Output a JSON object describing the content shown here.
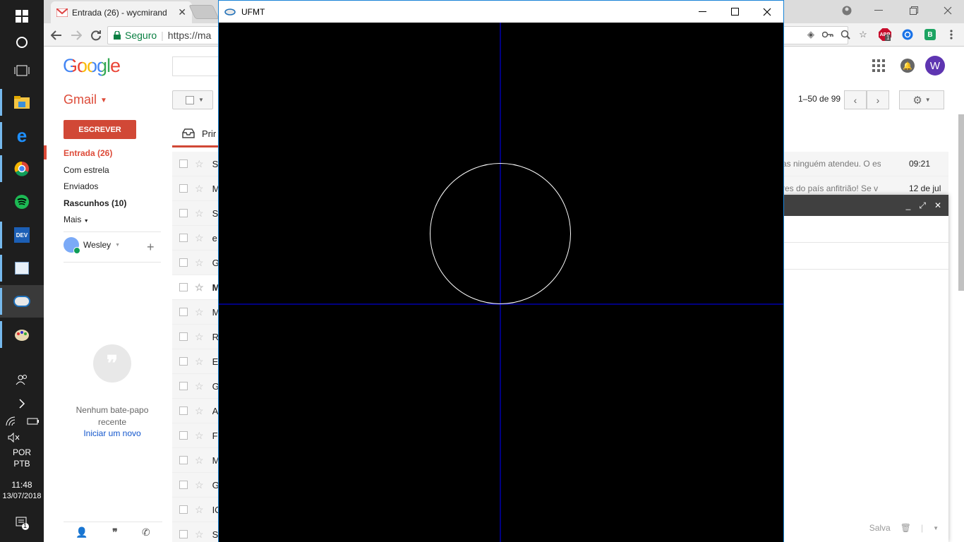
{
  "taskbar": {
    "lang_line1": "POR",
    "lang_line2": "PTB",
    "time": "11:48",
    "date": "13/07/2018",
    "notification_count": "1"
  },
  "chrome": {
    "tab_title": "Entrada (26) - wycmirand",
    "secure_label": "Seguro",
    "url": "https://ma",
    "abp_badge": "1"
  },
  "gmail": {
    "logo": "Google",
    "product": "Gmail",
    "compose": "ESCREVER",
    "nav": {
      "inbox": "Entrada (26)",
      "starred": "Com estrela",
      "sent": "Enviados",
      "drafts": "Rascunhos (10)",
      "more": "Mais"
    },
    "user": "Wesley",
    "avatar_letter": "W",
    "pager": "1–50 de 99",
    "inbox_tab": "Prir",
    "no_chat": "Nenhum bate-papo recente",
    "start_chat": "Iniciar um novo",
    "compose_save": "Salva",
    "emails": [
      {
        "sender": "S",
        "snippet": "as ninguém atendeu. O es",
        "date": "09:21",
        "unread": false
      },
      {
        "sender": "M",
        "snippet": "res do país anfitrião! Se v",
        "date": "12 de jul",
        "unread": false
      },
      {
        "sender": "S",
        "snippet": "",
        "date": "",
        "unread": false
      },
      {
        "sender": "e",
        "snippet": "",
        "date": "",
        "unread": false
      },
      {
        "sender": "G",
        "snippet": "",
        "date": "",
        "unread": false
      },
      {
        "sender": "M",
        "snippet": "",
        "date": "",
        "unread": true
      },
      {
        "sender": "M",
        "snippet": "",
        "date": "",
        "unread": false
      },
      {
        "sender": "R",
        "snippet": "",
        "date": "",
        "unread": false
      },
      {
        "sender": "E",
        "snippet": "",
        "date": "",
        "unread": false
      },
      {
        "sender": "G",
        "snippet": "",
        "date": "",
        "unread": false
      },
      {
        "sender": "A",
        "snippet": "",
        "date": "",
        "unread": false
      },
      {
        "sender": "F",
        "snippet": "",
        "date": "",
        "unread": false
      },
      {
        "sender": "M",
        "snippet": "",
        "date": "",
        "unread": false
      },
      {
        "sender": "G",
        "snippet": "",
        "date": "",
        "unread": false
      },
      {
        "sender": "IC",
        "snippet": "",
        "date": "",
        "unread": false
      },
      {
        "sender": "S",
        "snippet": "",
        "date": "",
        "unread": false
      }
    ]
  },
  "ufmt": {
    "title": "UFMT",
    "canvas_colors": {
      "background": "#000000",
      "axes": "#0000ff",
      "circle": "#ffffff"
    }
  }
}
